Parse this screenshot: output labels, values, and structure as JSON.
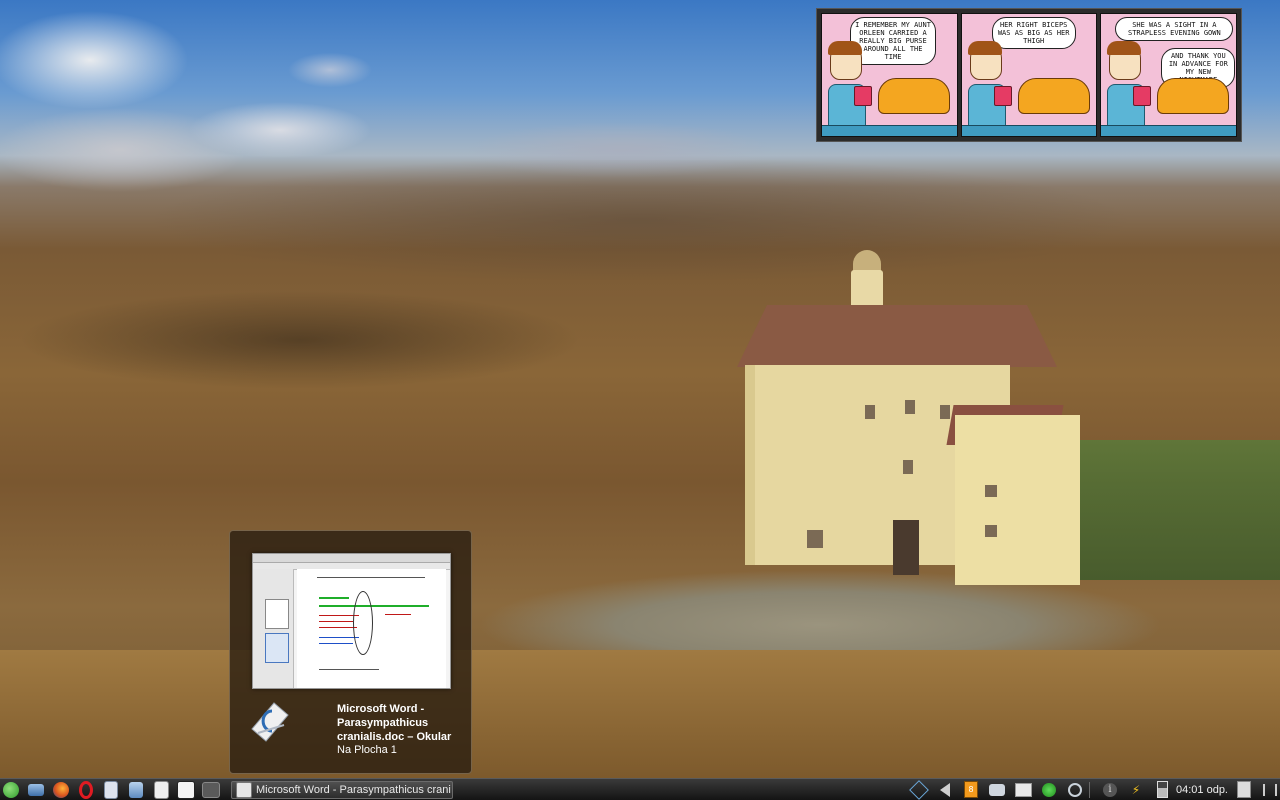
{
  "comic": {
    "panels": [
      {
        "text": "I remember my aunt Orleen carried a REALLY big purse around all the time"
      },
      {
        "text": "Her right biceps was as big as her thigh"
      },
      {
        "text": "She was a sight in a strapless evening gown"
      },
      {
        "text": "And thank you in advance for my new nightmare"
      }
    ]
  },
  "preview": {
    "window_title": "Microsoft Word - Parasympathicus cranialis.doc – Okular",
    "desktop_label": "Na Plocha 1",
    "app_icon": "okular-icon"
  },
  "taskbar": {
    "launchers": [
      {
        "name": "kickoff-menu-icon",
        "color": "#4bb84a"
      },
      {
        "name": "show-desktop-icon",
        "color": "#4f7fb4"
      },
      {
        "name": "firefox-icon",
        "color": "#e66a1c"
      },
      {
        "name": "opera-icon",
        "color": "#d9161c"
      },
      {
        "name": "notes-icon",
        "color": "#cfd6e6"
      },
      {
        "name": "file-manager-icon",
        "color": "#7fa9d6"
      },
      {
        "name": "text-editor-icon",
        "color": "#e4e4e4"
      },
      {
        "name": "kolourpaint-icon",
        "color": "#f0f0f0"
      },
      {
        "name": "pager-icon",
        "color": "#5e5e5e"
      }
    ],
    "task_label": "Microsoft Word - Parasympathicus crani",
    "tray": [
      {
        "name": "network-manager-icon"
      },
      {
        "name": "volume-icon"
      },
      {
        "name": "clipboard-icon"
      },
      {
        "name": "notifications-icon"
      },
      {
        "name": "folder-icon"
      },
      {
        "name": "update-icon"
      },
      {
        "name": "wifi-icon"
      },
      {
        "name": "info-icon"
      },
      {
        "name": "power-icon"
      },
      {
        "name": "battery-icon"
      }
    ],
    "clock": "04:01 odp."
  }
}
